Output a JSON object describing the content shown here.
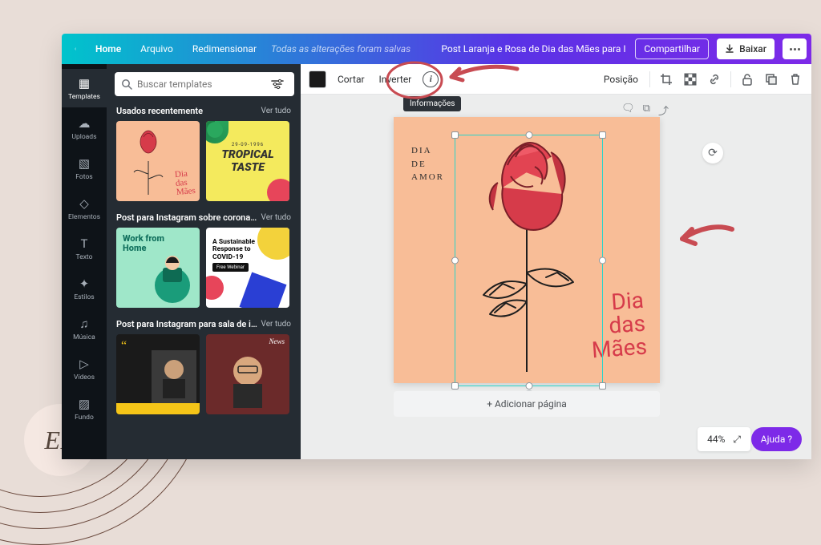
{
  "header": {
    "home": "Home",
    "file": "Arquivo",
    "resize": "Redimensionar",
    "saved_status": "Todas as alterações foram salvas",
    "doc_title": "Post Laranja e Rosa de Dia das Mães para In…",
    "share": "Compartilhar",
    "download": "Baixar"
  },
  "rail": [
    {
      "label": "Templates",
      "icon": "▦"
    },
    {
      "label": "Uploads",
      "icon": "☁"
    },
    {
      "label": "Fotos",
      "icon": "▧"
    },
    {
      "label": "Elementos",
      "icon": "◇"
    },
    {
      "label": "Texto",
      "icon": "T"
    },
    {
      "label": "Estilos",
      "icon": "✦"
    },
    {
      "label": "Música",
      "icon": "♫"
    },
    {
      "label": "Vídeos",
      "icon": "▷"
    },
    {
      "label": "Fundo",
      "icon": "▨"
    }
  ],
  "panel": {
    "search_placeholder": "Buscar templates",
    "sections": [
      {
        "title": "Usados recentemente",
        "see_all": "Ver tudo",
        "thumbs": [
          {
            "kind": "rose",
            "script": "Dia\ndas\nMães"
          },
          {
            "kind": "tropical",
            "line1": "TROPICAL",
            "line2": "TASTE",
            "date": "29-09-1996"
          }
        ]
      },
      {
        "title": "Post para Instagram sobre corona…",
        "see_all": "Ver tudo",
        "thumbs": [
          {
            "kind": "work",
            "line1": "Work from",
            "line2": "Home"
          },
          {
            "kind": "covid",
            "headline": "A Sustainable Response to COVID-19",
            "button": "Free Webinar"
          }
        ]
      },
      {
        "title": "Post para Instagram para sala de i…",
        "see_all": "Ver tudo",
        "thumbs": [
          {
            "kind": "news1"
          },
          {
            "kind": "news2",
            "tag": "News"
          }
        ]
      }
    ]
  },
  "toolbar": {
    "crop": "Cortar",
    "flip": "Inverter",
    "tooltip": "Informações",
    "position": "Posição"
  },
  "canvas": {
    "text_block": "DIA\nDE\nAMOR",
    "script_lines": [
      "Dia",
      "das",
      "Mães"
    ],
    "add_page": "+ Adicionar página"
  },
  "footer": {
    "zoom": "44%",
    "help": "Ajuda  ?"
  },
  "badge": "EB"
}
